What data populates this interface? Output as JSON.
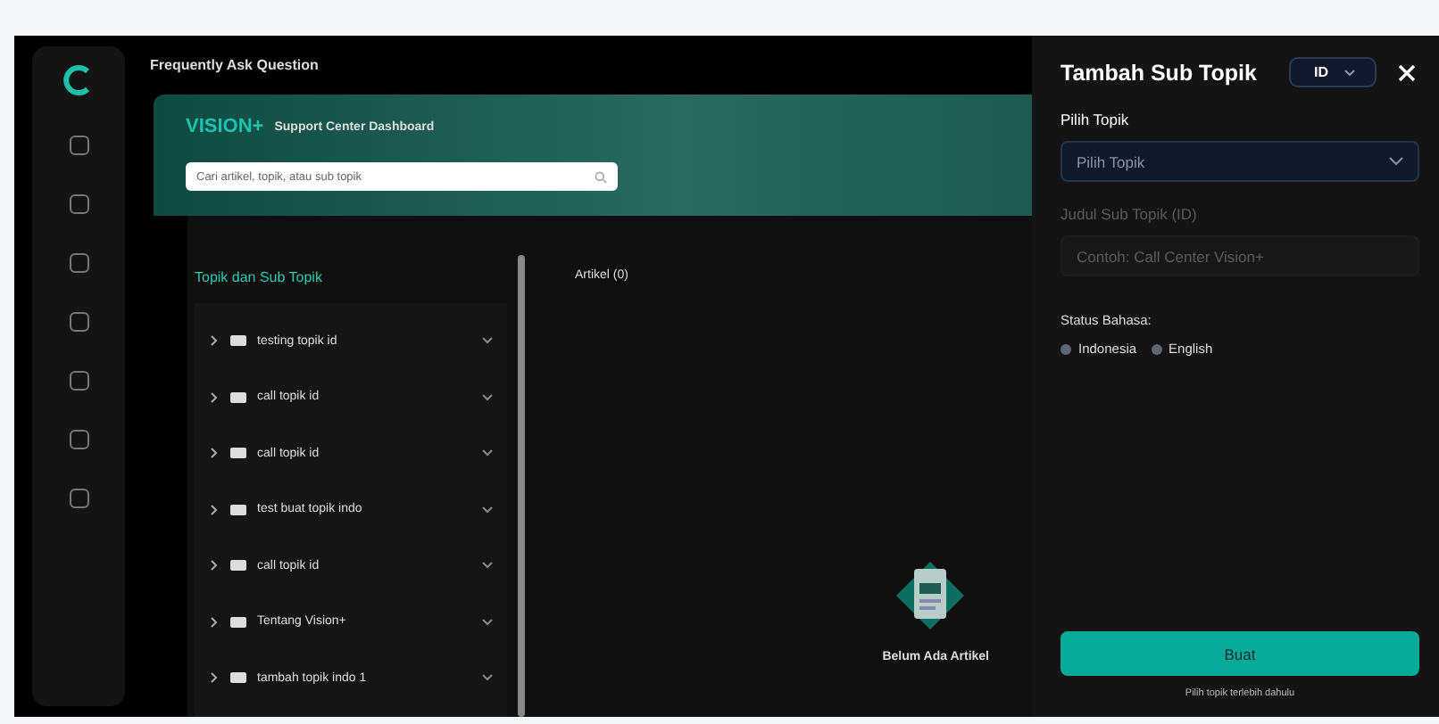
{
  "background": {
    "page_title": "Frequently Ask Question",
    "brand": "VISION+",
    "brand_subtitle": "Support Center Dashboard",
    "search": {
      "placeholder": "Cari artikel, topik, atau sub topik"
    },
    "tree_title": "Topik dan Sub Topik",
    "articles_label": "Artikel (0)",
    "topics": [
      {
        "label": "testing topik id",
        "expanded": false
      },
      {
        "label": "call topik id",
        "expanded": false
      },
      {
        "label": "call topik id",
        "expanded": false
      },
      {
        "label": "test buat topik indo",
        "expanded": false
      },
      {
        "label": "call topik id",
        "expanded": false
      },
      {
        "label": "Tentang Vision+",
        "expanded": false
      },
      {
        "label": "tambah topik indo 1",
        "expanded": false
      }
    ],
    "empty_title": "Belum Ada Artikel"
  },
  "panel": {
    "title": "Tambah Sub Topik",
    "language": "ID",
    "fields": [
      {
        "kind": "select",
        "label": "Pilih Topik",
        "placeholder": "Pilih Topik",
        "disabled": false
      },
      {
        "kind": "text",
        "label": "Judul Sub Topik (ID)",
        "placeholder": "Contoh: Call Center Vision+",
        "disabled": true
      }
    ],
    "status_label": "Status Bahasa:",
    "statuses": [
      {
        "label": "Indonesia",
        "on": false
      },
      {
        "label": "English",
        "on": false
      }
    ],
    "submit": {
      "label": "Buat",
      "disabled": false
    },
    "hint": "Pilih topik terlebih dahulu"
  }
}
